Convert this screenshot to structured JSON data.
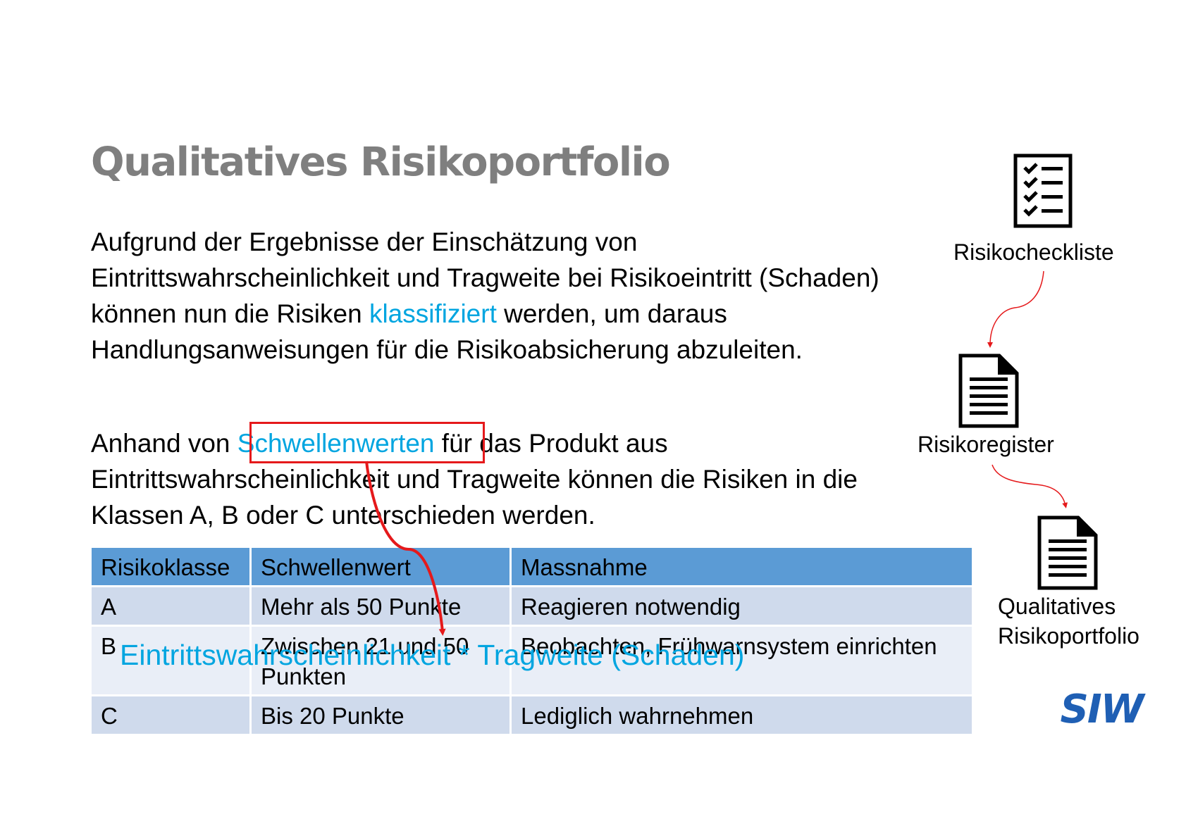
{
  "slide": {
    "title": "Qualitatives Risikoportfolio",
    "para1": {
      "before": "Aufgrund der Ergebnisse der Einschätzung von Eintrittswahrscheinlichkeit und Tragweite bei Risikoeintritt (Schaden) können nun die Risiken ",
      "highlight": "klassifiziert",
      "after": " werden, um daraus Handlungsanweisungen für die Risikoabsicherung abzuleiten."
    },
    "para2": {
      "before": "Anhand von ",
      "highlight": "Schwellenwerten",
      "after": " für das Produkt aus Eintrittswahrscheinlichkeit und Tragweite können die Risiken in die Klassen A, B oder C unterschieden werden."
    },
    "formula": "Eintrittswahrscheinlichkeit * Tragweite (Schaden)"
  },
  "table": {
    "headers": [
      "Risikoklasse",
      "Schwellenwert",
      "Massnahme"
    ],
    "rows": [
      [
        "A",
        "Mehr als 50 Punkte",
        "Reagieren notwendig"
      ],
      [
        "B",
        "Zwischen 21 und 50 Punkten",
        "Beobachten, Frühwarnsystem einrichten"
      ],
      [
        "C",
        "Bis 20 Punkte",
        "Lediglich wahrnehmen"
      ]
    ]
  },
  "sidebar": {
    "steps": [
      {
        "label": "Risikocheckliste",
        "icon": "checklist-icon"
      },
      {
        "label": "Risikoregister",
        "icon": "document-icon"
      },
      {
        "label_line1": "Qualitatives",
        "label_line2": "Risikoportfolio",
        "icon": "document-icon"
      }
    ]
  },
  "logo": {
    "text": "SIW",
    "color": "#1f5fb4"
  },
  "colors": {
    "title": "#7f7f7f",
    "highlight_text": "#00a5e0",
    "highlight_box": "#e5191b",
    "arrow": "#e5191b",
    "table_header": "#5b9bd5",
    "table_row_odd": "#cfdaec",
    "table_row_even": "#e9eef7"
  }
}
